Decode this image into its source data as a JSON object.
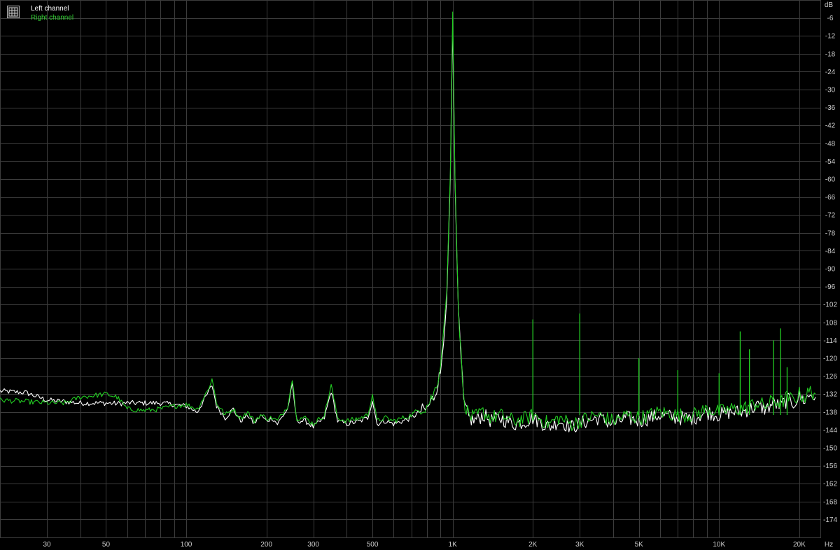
{
  "legend": {
    "left_label": "Left channel",
    "right_label": "Right channel"
  },
  "colors": {
    "background": "#000000",
    "grid": "#3c3c3c",
    "left": "#ffffff",
    "right": "#22cc22",
    "text": "#cfcfcf"
  },
  "chart_data": {
    "type": "line",
    "title": "",
    "xlabel": "Hz",
    "ylabel": "dB",
    "x_scale": "log",
    "xlim": [
      20,
      24000
    ],
    "ylim": [
      -180,
      0
    ],
    "grid": true,
    "legend_position": "top-left",
    "x_ticks": [
      {
        "value": 30,
        "label": "30"
      },
      {
        "value": 50,
        "label": "50"
      },
      {
        "value": 100,
        "label": "100"
      },
      {
        "value": 200,
        "label": "200"
      },
      {
        "value": 300,
        "label": "300"
      },
      {
        "value": 500,
        "label": "500"
      },
      {
        "value": 1000,
        "label": "1K"
      },
      {
        "value": 2000,
        "label": "2K"
      },
      {
        "value": 3000,
        "label": "3K"
      },
      {
        "value": 5000,
        "label": "5K"
      },
      {
        "value": 10000,
        "label": "10K"
      },
      {
        "value": 20000,
        "label": "20K"
      }
    ],
    "x_grid": [
      30,
      40,
      50,
      60,
      70,
      80,
      90,
      100,
      200,
      300,
      400,
      500,
      600,
      700,
      800,
      900,
      1000,
      2000,
      3000,
      4000,
      5000,
      6000,
      7000,
      8000,
      9000,
      10000,
      20000
    ],
    "y_ticks": [
      -6,
      -12,
      -18,
      -24,
      -30,
      -36,
      -42,
      -48,
      -54,
      -60,
      -66,
      -72,
      -78,
      -84,
      -90,
      -96,
      -102,
      -108,
      -114,
      -120,
      -126,
      -132,
      -138,
      -144,
      -150,
      -156,
      -162,
      -168,
      -174
    ],
    "series": [
      {
        "name": "Left channel",
        "color": "#ffffff",
        "x": [
          20,
          25,
          30,
          35,
          40,
          50,
          55,
          60,
          70,
          80,
          90,
          100,
          110,
          120,
          125,
          130,
          140,
          150,
          160,
          170,
          180,
          190,
          200,
          210,
          220,
          240,
          250,
          260,
          280,
          300,
          330,
          350,
          370,
          400,
          450,
          480,
          500,
          520,
          560,
          600,
          650,
          700,
          750,
          800,
          850,
          900,
          950,
          980,
          1000,
          1020,
          1050,
          1100,
          1150,
          1200,
          1300,
          1400,
          1500,
          1700,
          1900,
          2000,
          2100,
          2300,
          2500,
          2800,
          3000,
          3200,
          3500,
          4000,
          4500,
          5000,
          5500,
          6000,
          7000,
          8000,
          9000,
          10000,
          11000,
          12000,
          13000,
          14000,
          15000,
          16000,
          17000,
          18000,
          19000,
          20000,
          21000,
          22000,
          23000
        ],
        "y": [
          -131,
          -131.5,
          -134,
          -134.5,
          -135,
          -135,
          -135.2,
          -135,
          -135,
          -135,
          -135.5,
          -136,
          -138,
          -132,
          -129,
          -136,
          -140,
          -137,
          -141,
          -139,
          -142,
          -139,
          -141,
          -140,
          -142,
          -137,
          -129,
          -141,
          -141,
          -143,
          -140,
          -131,
          -141,
          -142,
          -141,
          -140,
          -134,
          -142,
          -141,
          -142,
          -141,
          -140,
          -138,
          -137,
          -133,
          -125,
          -100,
          -60,
          -8,
          -60,
          -105,
          -135,
          -140,
          -141,
          -139,
          -141,
          -140,
          -142,
          -141,
          -140,
          -141,
          -143,
          -141,
          -143,
          -142,
          -141,
          -140,
          -142,
          -140,
          -141,
          -140,
          -139,
          -140,
          -140,
          -138,
          -139,
          -138,
          -138,
          -137,
          -136,
          -137,
          -135,
          -136,
          -134,
          -135,
          -133,
          -134,
          -132,
          -133
        ]
      },
      {
        "name": "Right channel",
        "color": "#22cc22",
        "x": [
          20,
          25,
          30,
          35,
          40,
          50,
          55,
          60,
          70,
          80,
          90,
          100,
          110,
          120,
          125,
          130,
          140,
          150,
          160,
          170,
          180,
          190,
          200,
          210,
          220,
          240,
          250,
          260,
          280,
          300,
          330,
          350,
          370,
          400,
          450,
          480,
          500,
          520,
          560,
          600,
          650,
          700,
          750,
          800,
          850,
          900,
          950,
          980,
          1000,
          1020,
          1050,
          1100,
          1150,
          1200,
          1300,
          1400,
          1500,
          1700,
          1900,
          2000,
          2100,
          2300,
          2500,
          2800,
          3000,
          3200,
          3500,
          4000,
          4500,
          5000,
          5500,
          6000,
          7000,
          8000,
          9000,
          10000,
          11000,
          12000,
          13000,
          14000,
          15000,
          16000,
          17000,
          18000,
          19000,
          20000,
          21000,
          22000,
          23000
        ],
        "y": [
          -134,
          -134.5,
          -135,
          -135,
          -133,
          -132,
          -133,
          -137,
          -137.5,
          -137,
          -136,
          -135.5,
          -137,
          -131,
          -127,
          -135,
          -139,
          -137,
          -140,
          -138,
          -141,
          -139,
          -140,
          -140,
          -141,
          -136,
          -127,
          -140,
          -140,
          -142,
          -139,
          -129,
          -140,
          -141,
          -140,
          -139,
          -132,
          -141,
          -140,
          -141,
          -140,
          -139,
          -137,
          -136,
          -132,
          -123,
          -98,
          -58,
          -4,
          -58,
          -103,
          -134,
          -139,
          -140,
          -138,
          -140,
          -139,
          -141,
          -140,
          -139,
          -140,
          -142,
          -140,
          -142,
          -141,
          -140,
          -139,
          -141,
          -139,
          -140,
          -139,
          -138,
          -139,
          -139,
          -137,
          -138,
          -137,
          -137,
          -136,
          -135,
          -136,
          -134,
          -135,
          -133,
          -134,
          -132,
          -133,
          -131,
          -132
        ],
        "spurs": [
          {
            "x": 2000,
            "y": -107
          },
          {
            "x": 3000,
            "y": -105
          },
          {
            "x": 5000,
            "y": -120
          },
          {
            "x": 7000,
            "y": -124
          },
          {
            "x": 10000,
            "y": -125
          },
          {
            "x": 12000,
            "y": -111
          },
          {
            "x": 13000,
            "y": -117
          },
          {
            "x": 16000,
            "y": -114
          },
          {
            "x": 17000,
            "y": -110
          },
          {
            "x": 18000,
            "y": -123
          }
        ]
      }
    ]
  }
}
